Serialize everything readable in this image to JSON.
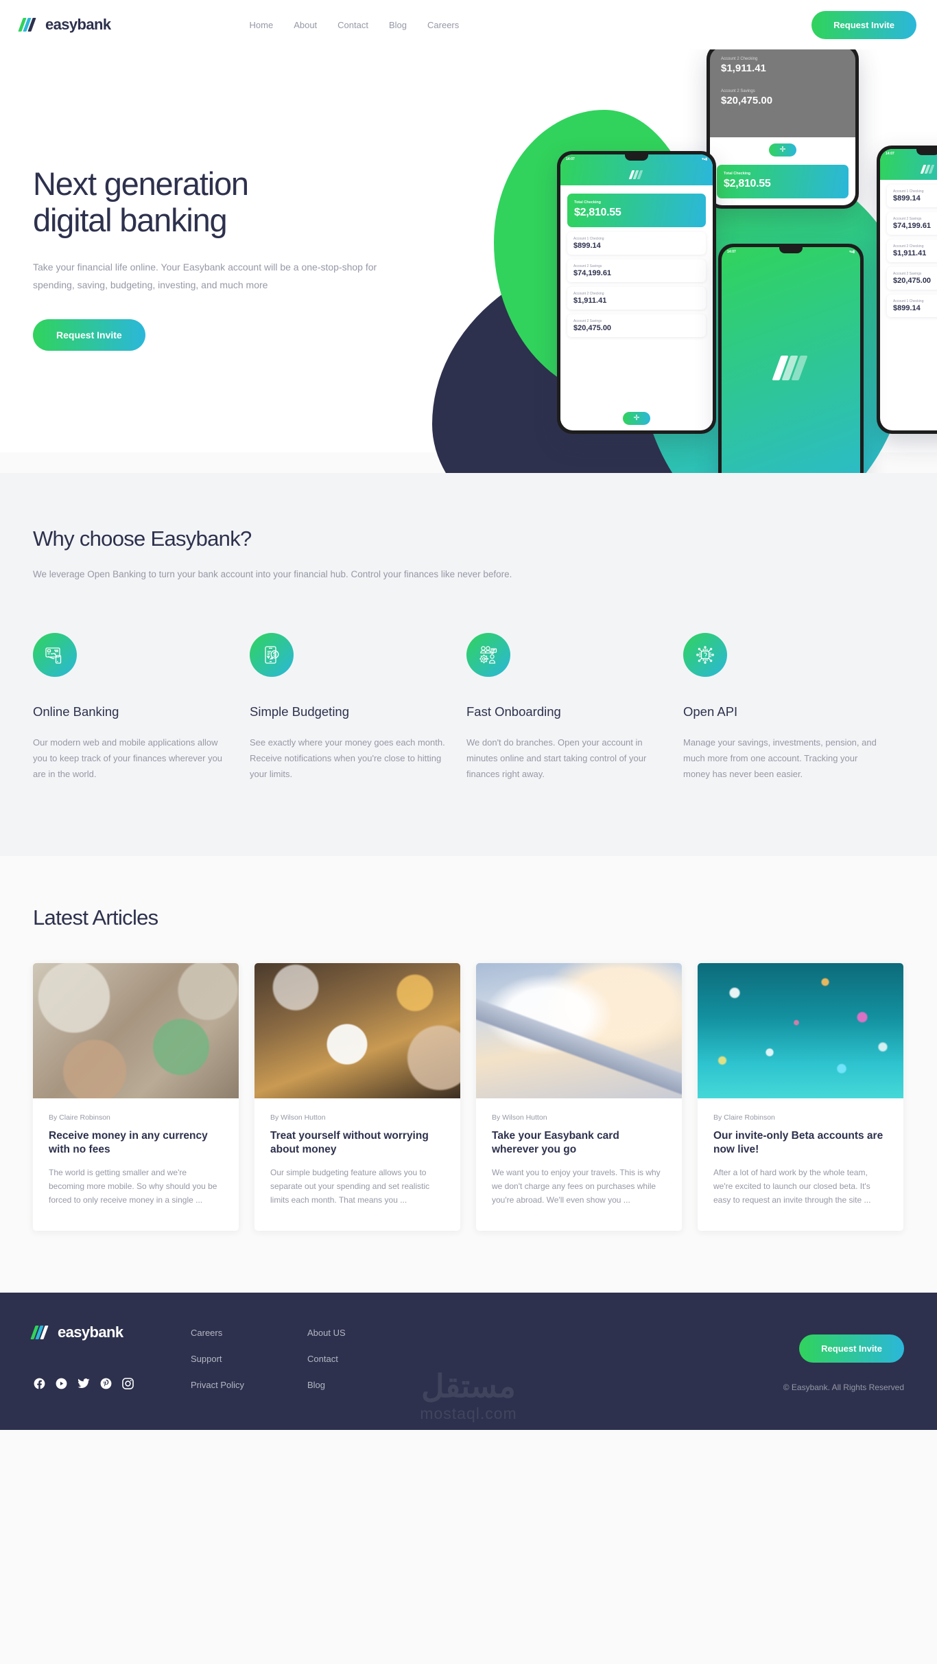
{
  "brand": {
    "name": "easybank",
    "logo_icon": "easybank-slashes-logo"
  },
  "header": {
    "nav": [
      {
        "label": "Home"
      },
      {
        "label": "About"
      },
      {
        "label": "Contact"
      },
      {
        "label": "Blog"
      },
      {
        "label": "Careers"
      }
    ],
    "cta_label": "Request Invite"
  },
  "hero": {
    "title_line1": "Next generation",
    "title_line2": "digital banking",
    "paragraph": "Take your financial life online. Your Easybank account will be a one-stop-shop for spending, saving, budgeting, investing, and much more",
    "cta_label": "Request Invite",
    "phone_status_time": "14:07",
    "phone_ui": {
      "total_label": "Total Checking",
      "total_amount": "$2,810.55",
      "accounts": [
        {
          "label": "Account 1 Checking",
          "amount": "$899.14"
        },
        {
          "label": "Account 2 Savings",
          "amount": "$74,199.61"
        },
        {
          "label": "Account 2 Checking",
          "amount": "$1,911.41"
        },
        {
          "label": "Account 2 Savings",
          "amount": "$20,475.00"
        }
      ],
      "fab_icon": "plus-icon"
    },
    "colors": {
      "green": "#31d35c",
      "cyan": "#2bb7da",
      "navy": "#2d314d"
    }
  },
  "features": {
    "heading": "Why choose Easybank?",
    "subheading": "We leverage Open Banking to turn your bank account into your financial hub. Control your finances like never before.",
    "items": [
      {
        "icon": "card-in-hand-icon",
        "title": "Online Banking",
        "desc": "Our modern web and mobile applications allow you to keep track of your finances wherever you are in the world."
      },
      {
        "icon": "phone-money-budget-icon",
        "title": "Simple Budgeting",
        "desc": "See exactly where your money goes each month. Receive notifications when you're close to hitting your limits."
      },
      {
        "icon": "people-gear-onboarding-icon",
        "title": "Fast Onboarding",
        "desc": "We don't do branches. Open your account in minutes online and start taking control of your finances right away."
      },
      {
        "icon": "circuit-chip-api-icon",
        "title": "Open API",
        "desc": "Manage your savings, investments, pension, and much more from one account. Tracking your money has never been easier."
      }
    ]
  },
  "articles": {
    "heading": "Latest Articles",
    "items": [
      {
        "image": "currency-banknotes-photo",
        "author": "By Claire Robinson",
        "title": "Receive money in any currency with no fees",
        "summary": "The world is getting smaller and we're becoming more mobile. So why should you be forced to only receive money in a single ..."
      },
      {
        "image": "restaurant-dining-photo",
        "author": "By Wilson Hutton",
        "title": "Treat yourself without worrying about money",
        "summary": "Our simple budgeting feature allows you to separate out your spending and set realistic limits each month. That means you ..."
      },
      {
        "image": "airplane-wing-clouds-photo",
        "author": "By Wilson Hutton",
        "title": "Take your Easybank card wherever you go",
        "summary": "We want you to enjoy your travels. This is why we don't charge any fees on purchases while you're abroad. We'll even show you ..."
      },
      {
        "image": "confetti-teal-photo",
        "author": "By Claire Robinson",
        "title": "Our invite-only Beta accounts are now live!",
        "summary": "After a lot of hard work by the whole team, we're excited to launch our closed beta. It's easy to request an invite through the site ..."
      }
    ]
  },
  "footer": {
    "socials": [
      {
        "icon": "facebook-icon"
      },
      {
        "icon": "youtube-icon"
      },
      {
        "icon": "twitter-icon"
      },
      {
        "icon": "pinterest-icon"
      },
      {
        "icon": "instagram-icon"
      }
    ],
    "col1": [
      {
        "label": "Careers"
      },
      {
        "label": "Support"
      },
      {
        "label": "Privact Policy"
      }
    ],
    "col2": [
      {
        "label": "About US"
      },
      {
        "label": "Contact"
      },
      {
        "label": "Blog"
      }
    ],
    "cta_label": "Request Invite",
    "copyright": "© Easybank. All Rights Reserved",
    "watermark_ar": "مستقل",
    "watermark_en": "mostaql.com"
  }
}
